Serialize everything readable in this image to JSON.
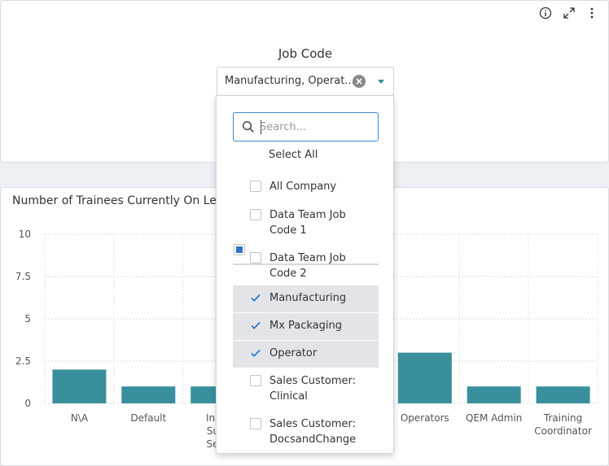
{
  "toolbar": {
    "info_icon": "info-icon",
    "expand_icon": "expand-icon",
    "more_icon": "more-vertical-icon"
  },
  "filter": {
    "label": "Job Code",
    "selected_value": "Manufacturing, Operat...",
    "search_placeholder": "Search...",
    "select_all_label": "Select All",
    "options": [
      {
        "label": "All Company",
        "checked": false
      },
      {
        "label": "Data Team Job Code 1",
        "checked": false
      },
      {
        "label": "Data Team Job Code 2",
        "checked": false
      },
      {
        "label": "Manufacturing",
        "checked": true
      },
      {
        "label": "Mx Packaging",
        "checked": true
      },
      {
        "label": "Operator",
        "checked": true
      },
      {
        "label": "Sales Customer: Clinical",
        "checked": false
      },
      {
        "label": "Sales Customer: DocsandChange",
        "checked": false
      }
    ]
  },
  "chart_data": {
    "type": "bar",
    "title": "Number of Trainees Currently On Le",
    "categories": [
      "N\\A",
      "Default",
      "Insig Sum Sess",
      "",
      "",
      "Operators",
      "QEM Admin",
      "Training Coordinator"
    ],
    "category_lines": [
      [
        "N\\A"
      ],
      [
        "Default"
      ],
      [
        "Insig",
        "Sum",
        "Sess"
      ],
      [
        ""
      ],
      [
        ""
      ],
      [
        "Operators"
      ],
      [
        "QEM Admin"
      ],
      [
        "Training",
        "Coordinator"
      ]
    ],
    "values": [
      2,
      1,
      1,
      null,
      null,
      3,
      1,
      1
    ],
    "yticks": [
      "10",
      "7.5",
      "5",
      "2.5",
      "0"
    ],
    "ylim": [
      0,
      10
    ],
    "grid": true,
    "bar_color": "#3a8f9c"
  },
  "colors": {
    "accent": "#2f73c4",
    "bar": "#3a8f9c"
  }
}
